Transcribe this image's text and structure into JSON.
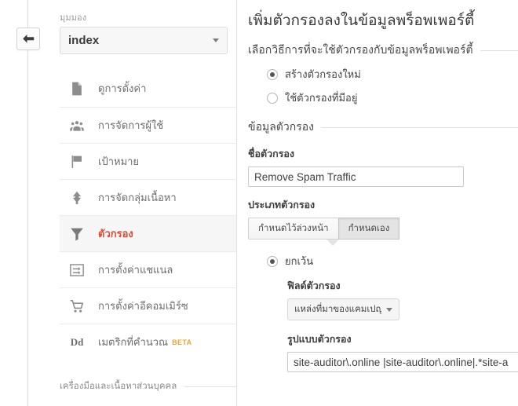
{
  "left_pane": {
    "back_button": {
      "name": "back-arrow-icon",
      "title": "ย้อนกลับ"
    },
    "view_selector": {
      "label": "มุมมอง",
      "value": "index",
      "caret_icon": "chevron-down-icon"
    },
    "nav_items": [
      {
        "icon": "document-icon",
        "label": "ดูการตั้งค่า",
        "active": false,
        "badge": ""
      },
      {
        "icon": "users-icon",
        "label": "การจัดการผู้ใช้",
        "active": false,
        "badge": ""
      },
      {
        "icon": "flag-icon",
        "label": "เป้าหมาย",
        "active": false,
        "badge": ""
      },
      {
        "icon": "content-group-icon",
        "label": "การจัดกลุ่มเนื้อหา",
        "active": false,
        "badge": ""
      },
      {
        "icon": "funnel-icon",
        "label": "ตัวกรอง",
        "active": true,
        "badge": ""
      },
      {
        "icon": "channel-icon",
        "label": "การตั้งค่าแชแนล",
        "active": false,
        "badge": ""
      },
      {
        "icon": "cart-icon",
        "label": "การตั้งค่าอีคอมเมิร์ซ",
        "active": false,
        "badge": ""
      },
      {
        "icon": "dd-icon",
        "label": "เมตริกที่คำนวณ",
        "active": false,
        "badge": "BETA"
      }
    ],
    "personal_section_title": "เครื่องมือและเนื้อหาส่วนบุคคล"
  },
  "right_pane": {
    "page_title": "เพิ่มตัวกรองลงในข้อมูลพร็อพเพอร์ตี้",
    "method_section_title": "เลือกวิธีการที่จะใช้ตัวกรองกับข้อมูลพร็อพเพอร์ตี้",
    "method_options": [
      {
        "label": "สร้างตัวกรองใหม่",
        "checked": true
      },
      {
        "label": "ใช้ตัวกรองที่มีอยู่",
        "checked": false
      }
    ],
    "filter_info_section_title": "ข้อมูลตัวกรอง",
    "filter_name": {
      "label": "ชื่อตัวกรอง",
      "value": "Remove Spam Traffic",
      "placeholder": ""
    },
    "filter_type": {
      "label": "ประเภทตัวกรอง",
      "options": [
        {
          "label": "กำหนดไว้ล่วงหน้า",
          "selected": false
        },
        {
          "label": "กำหนดเอง",
          "selected": true
        }
      ]
    },
    "custom_filter": {
      "mode_options": [
        {
          "label": "ยกเว้น",
          "checked": true
        }
      ],
      "field_label": "ฟิลด์ตัวกรอง",
      "field_value": "แหล่งที่มาของแคมเปญ",
      "field_caret_icon": "chevron-down-icon",
      "pattern_label": "รูปแบบตัวกรอง",
      "pattern_value": "site-auditor\\.online |site-auditor\\.online|.*site-a",
      "pattern_placeholder": ""
    }
  },
  "colors": {
    "accent_red": "#dd4b39",
    "beta_orange": "#e8a33d",
    "active_bg": "#f6f6f6",
    "text_primary": "#3a3a3a",
    "text_muted": "#6e6e6e",
    "border": "#e0e0e0"
  }
}
